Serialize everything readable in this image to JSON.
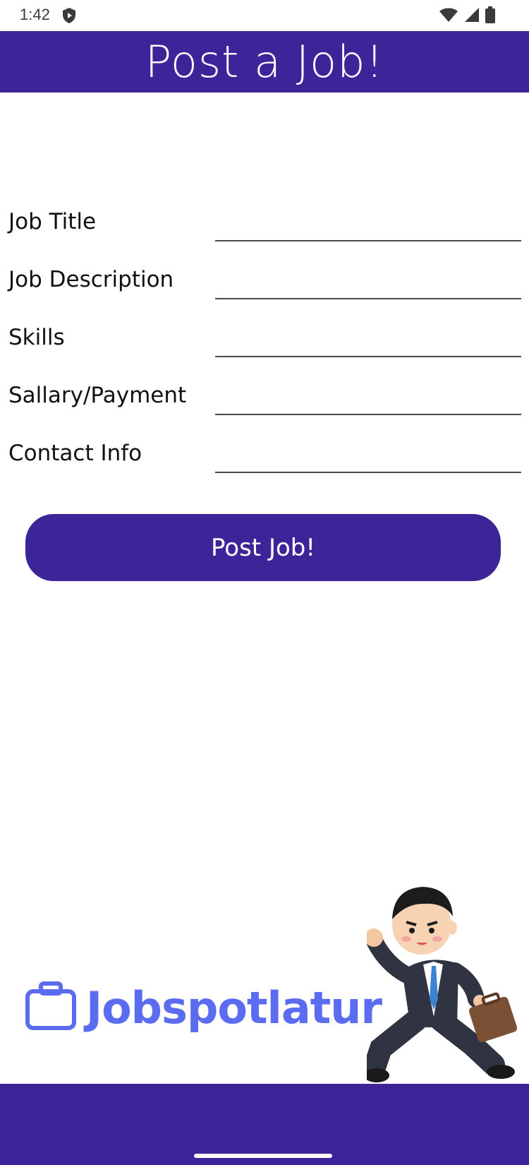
{
  "status_bar": {
    "time": "1:42"
  },
  "header": {
    "title": "Post a Job!"
  },
  "form": {
    "fields": [
      {
        "label": "Job Title",
        "value": ""
      },
      {
        "label": "Job Description",
        "value": ""
      },
      {
        "label": "Skills",
        "value": ""
      },
      {
        "label": "Sallary/Payment",
        "value": ""
      },
      {
        "label": "Contact Info",
        "value": ""
      }
    ],
    "submit_label": "Post Job!"
  },
  "branding": {
    "logo_text": "Jobspotlatur"
  },
  "colors": {
    "primary": "#3d2599",
    "logo": "#5b6cf0",
    "background": "#ffffff"
  }
}
